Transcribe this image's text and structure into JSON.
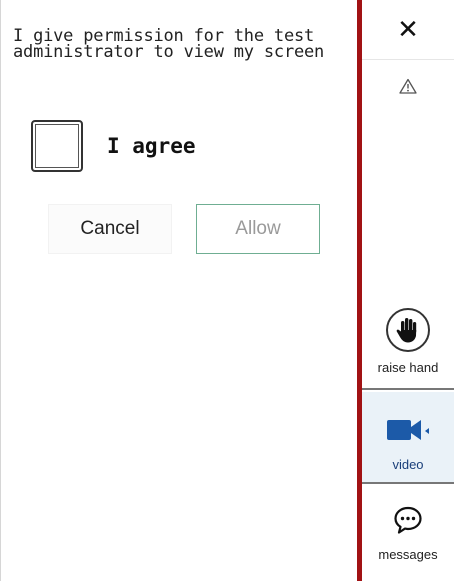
{
  "dialog": {
    "prompt": "I give permission for the test administrator to view my screen",
    "checkbox_label": "I agree",
    "checkbox_checked": false,
    "cancel_label": "Cancel",
    "allow_label": "Allow",
    "allow_enabled": false
  },
  "toolbar": {
    "close_glyph": "✕",
    "warning_icon": "warning-icon",
    "raise_hand_label": "raise hand",
    "video_label": "video",
    "messages_label": "messages"
  },
  "colors": {
    "divider": "#a11214",
    "video_icon": "#1c5aa8",
    "allow_border": "#6fae92"
  }
}
